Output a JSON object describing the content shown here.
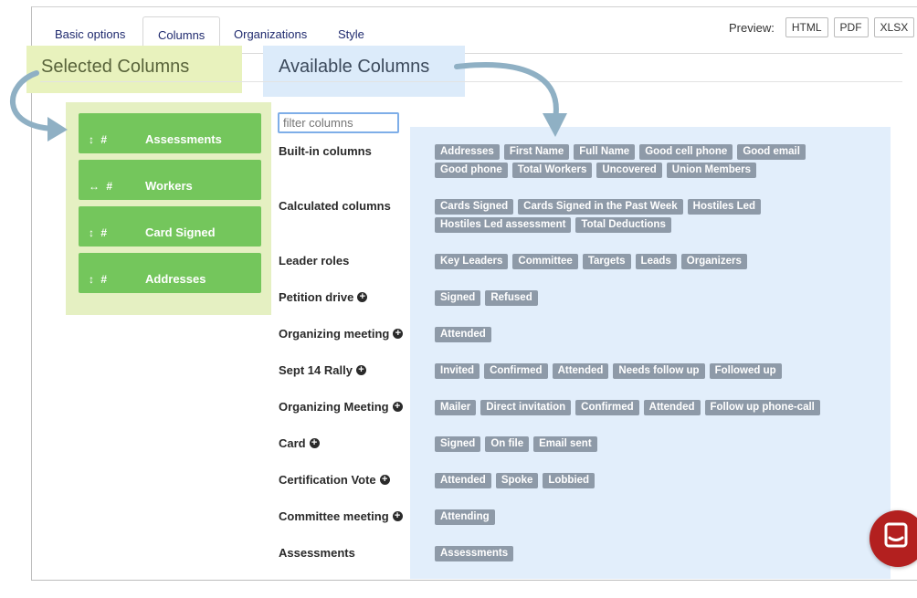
{
  "tabs": [
    {
      "label": "Basic options",
      "active": false
    },
    {
      "label": "Columns",
      "active": true
    },
    {
      "label": "Organizations",
      "active": false
    },
    {
      "label": "Style",
      "active": false
    }
  ],
  "preview": {
    "label": "Preview:",
    "buttons": [
      "HTML",
      "PDF",
      "XLSX"
    ]
  },
  "selected": {
    "heading": "Selected Columns",
    "items": [
      {
        "handle": "↕ #",
        "name": "Assessments"
      },
      {
        "handle": "↔ #",
        "name": "Workers"
      },
      {
        "handle": "↕ #",
        "name": "Card Signed"
      },
      {
        "handle": "↕ #",
        "name": "Addresses"
      }
    ]
  },
  "available": {
    "heading": "Available Columns",
    "filter_placeholder": "filter columns",
    "groups": [
      {
        "label": "Built-in columns",
        "expandable": false,
        "chips": [
          "Addresses",
          "First Name",
          "Full Name",
          "Good cell phone",
          "Good email",
          "Good phone",
          "Total Workers",
          "Uncovered",
          "Union Members"
        ]
      },
      {
        "label": "Calculated columns",
        "expandable": false,
        "chips": [
          "Cards Signed",
          "Cards Signed in the Past Week",
          "Hostiles Led",
          "Hostiles Led assessment",
          "Total Deductions"
        ]
      },
      {
        "label": "Leader roles",
        "expandable": false,
        "chips": [
          "Key Leaders",
          "Committee",
          "Targets",
          "Leads",
          "Organizers"
        ]
      },
      {
        "label": "Petition drive",
        "expandable": true,
        "chips": [
          "Signed",
          "Refused"
        ]
      },
      {
        "label": "Organizing meeting",
        "expandable": true,
        "chips": [
          "Attended"
        ]
      },
      {
        "label": "Sept 14 Rally",
        "expandable": true,
        "chips": [
          "Invited",
          "Confirmed",
          "Attended",
          "Needs follow up",
          "Followed up"
        ]
      },
      {
        "label": "Organizing Meeting",
        "expandable": true,
        "chips": [
          "Mailer",
          "Direct invitation",
          "Confirmed",
          "Attended",
          "Follow up phone-call"
        ]
      },
      {
        "label": "Card",
        "expandable": true,
        "chips": [
          "Signed",
          "On file",
          "Email sent"
        ]
      },
      {
        "label": "Certification Vote",
        "expandable": true,
        "chips": [
          "Attended",
          "Spoke",
          "Lobbied"
        ]
      },
      {
        "label": "Committee meeting",
        "expandable": true,
        "chips": [
          "Attending"
        ]
      },
      {
        "label": "Assessments",
        "expandable": false,
        "chips": [
          "Assessments"
        ]
      }
    ]
  },
  "colors": {
    "selected_item": "#74c65c",
    "selected_panel": "#e5f0c2",
    "available_panel": "#e2eefb",
    "chip": "#8e9aa8",
    "annotation_arrow": "#8fb0c4",
    "chat_button": "#b3201f"
  },
  "icons": {
    "plus": "plus-circle-icon",
    "chat": "chat-bubble-icon",
    "arrow": "curved-arrow-icon"
  }
}
